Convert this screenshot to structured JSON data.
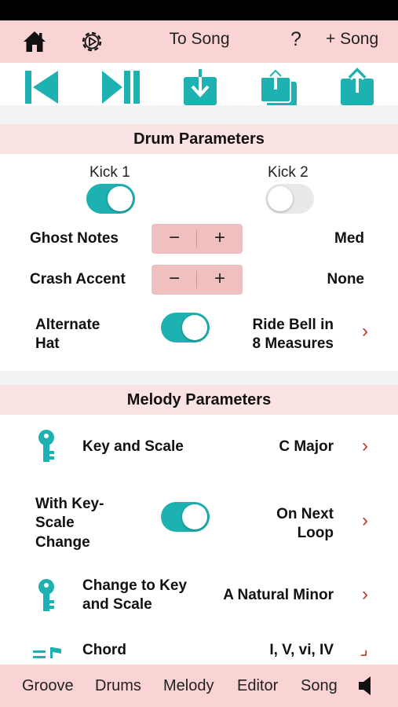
{
  "topbar": {
    "to_song": "To Song",
    "help": "?",
    "add_song": "+ Song"
  },
  "drum": {
    "header": "Drum Parameters",
    "kick1_label": "Kick 1",
    "kick1_on": true,
    "kick2_label": "Kick 2",
    "kick2_on": false,
    "ghost_label": "Ghost Notes",
    "ghost_value": "Med",
    "crash_label": "Crash Accent",
    "crash_value": "None",
    "minus": "−",
    "plus": "+",
    "alt_hat_line1": "Alternate",
    "alt_hat_line2": "Hat",
    "alt_hat_on": true,
    "ride_line1": "Ride Bell in",
    "ride_line2": "8 Measures"
  },
  "melody": {
    "header": "Melody Parameters",
    "key_scale_label": "Key and Scale",
    "key_scale_value": "C Major",
    "with_change_line1": "With Key-",
    "with_change_line2": "Scale",
    "with_change_line3": "Change",
    "with_change_on": true,
    "next_loop_line1": "On Next",
    "next_loop_line2": "Loop",
    "change_to_line1": "Change to Key",
    "change_to_line2": "and Scale",
    "change_to_value": "A Natural Minor",
    "chord_label": "Chord",
    "chord_value": "I, V, vi, IV"
  },
  "chevron": "›",
  "tabs": [
    "Groove",
    "Drums",
    "Melody",
    "Editor",
    "Song"
  ],
  "colors": {
    "accent": "#1eb1b1",
    "bar_bg": "#fad4d4",
    "chevron": "#c0392b"
  }
}
